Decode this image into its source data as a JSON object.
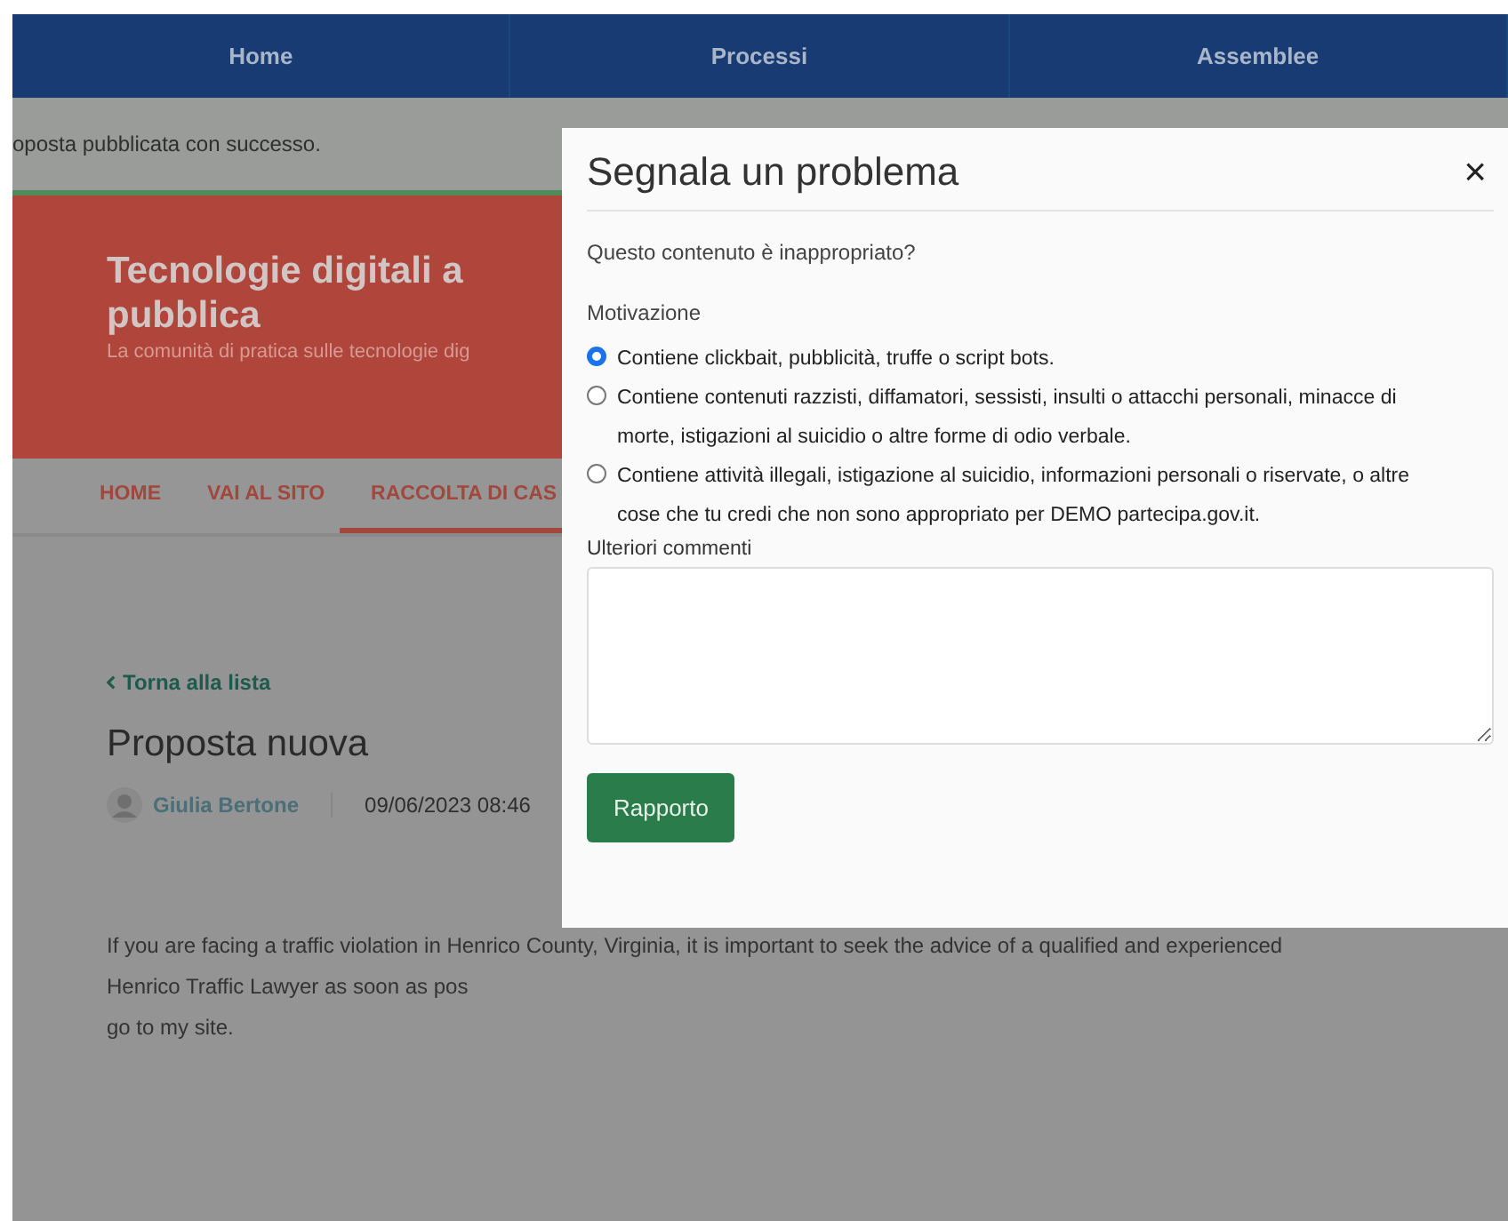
{
  "top_nav": [
    {
      "label": "Home"
    },
    {
      "label": "Processi"
    },
    {
      "label": "Assemblee"
    }
  ],
  "alert": {
    "text": "oposta pubblicata con successo."
  },
  "site_header": {
    "title_lines": [
      "Tecnologie digitali a",
      "pubblica"
    ],
    "subtitle": "La comunità di pratica sulle tecnologie dig"
  },
  "site_menu": [
    {
      "label": "HOME",
      "selected": false
    },
    {
      "label": "VAI AL SITO",
      "selected": false
    },
    {
      "label": "RACCOLTA DI CAS",
      "selected": true
    }
  ],
  "proposal": {
    "back_link": "Torna alla lista",
    "title": "Proposta nuova",
    "author": "Giulia Bertone",
    "date": "09/06/2023 08:46",
    "body": [
      "If you are facing a traffic violation in Henrico County, Virginia, it is important to seek the advice of a qualified and experienced",
      "Henrico Traffic Lawyer as soon as pos",
      "go to my site."
    ]
  },
  "modal": {
    "title": "Segnala un problema",
    "close": "×",
    "question": "Questo contenuto è inappropriato?",
    "reason_label": "Motivazione",
    "reasons": [
      {
        "label": "Contiene clickbait, pubblicità, truffe o script bots.",
        "selected": true
      },
      {
        "label": "Contiene contenuti razzisti, diffamatori, sessisti, insulti o attacchi personali, minacce di morte, istigazioni al suicidio o altre forme di odio verbale.",
        "selected": false
      },
      {
        "label": "Contiene attività illegali, istigazione al suicidio, informazioni personali o riservate, o altre cose che tu credi che non sono appropriato per DEMO partecipa.gov.it.",
        "selected": false
      }
    ],
    "comments_label": "Ulteriori commenti",
    "submit": "Rapporto"
  }
}
